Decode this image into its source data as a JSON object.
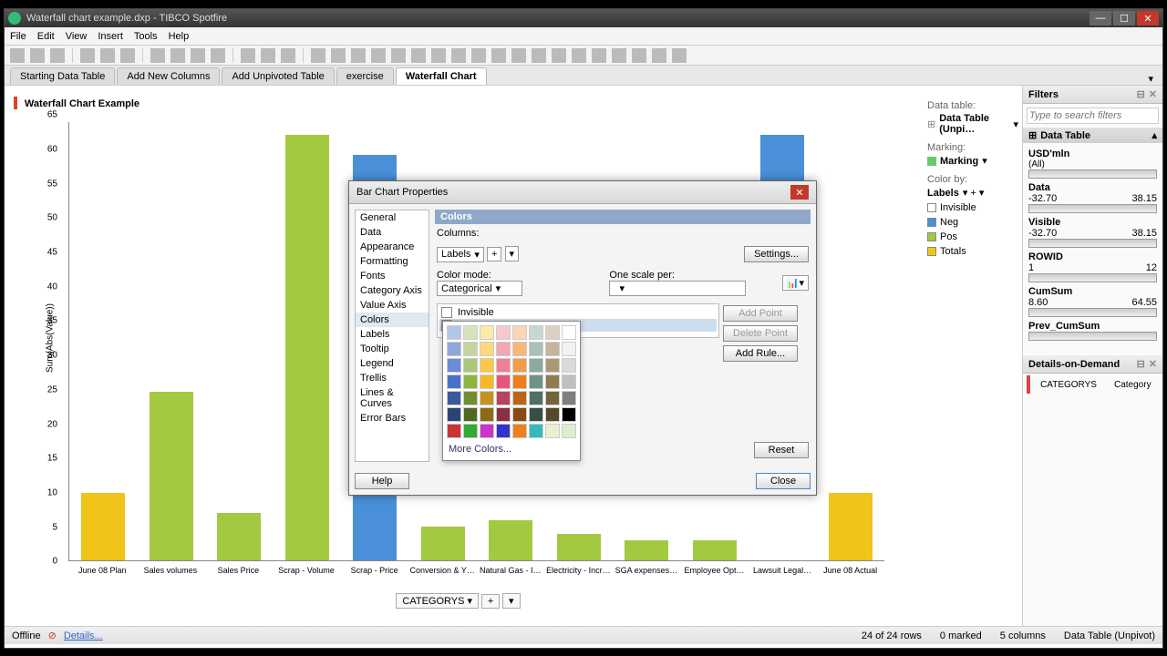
{
  "app": {
    "title": "Waterfall chart example.dxp - TIBCO Spotfire"
  },
  "menu": [
    "File",
    "Edit",
    "View",
    "Insert",
    "Tools",
    "Help"
  ],
  "tabs": [
    "Starting Data Table",
    "Add New Columns",
    "Add Unpivoted Table",
    "exercise",
    "Waterfall Chart"
  ],
  "active_tab": "Waterfall Chart",
  "page_title": "Waterfall Chart Example",
  "y_axis_label": "Sum(Abs(Value))",
  "x_axis_control": "CATEGORYS",
  "chart_data": {
    "type": "bar",
    "categories": [
      "June 08 Plan",
      "Sales volumes",
      "Sales Price",
      "Scrap - Volume",
      "Scrap - Price",
      "Conversion & Y…",
      "Natural Gas - I…",
      "Electricity - Incr…",
      "SGA expenses…",
      "Employee Opt…",
      "Lawsuit Legal…",
      "June 08 Actual"
    ],
    "values": [
      10,
      25,
      7,
      63,
      60,
      5,
      6,
      4,
      3,
      3,
      11,
      10
    ],
    "bar_bottoms": [
      0,
      0,
      0,
      0,
      0,
      0,
      0,
      0,
      0,
      0,
      52,
      0
    ],
    "colors": [
      "#f0c419",
      "#a2c940",
      "#a2c940",
      "#a2c940",
      "#4a90d9",
      "#a2c940",
      "#a2c940",
      "#a2c940",
      "#a2c940",
      "#a2c940",
      "#4a90d9",
      "#f0c419"
    ],
    "y_ticks": [
      0,
      5,
      10,
      15,
      20,
      25,
      30,
      35,
      40,
      45,
      50,
      55,
      60,
      65
    ],
    "y_max": 65
  },
  "legend": {
    "data_table_label": "Data table:",
    "data_table_value": "Data Table (Unpi…",
    "marking_label": "Marking:",
    "marking_value": "Marking",
    "colorby_label": "Color by:",
    "colorby_value": "Labels",
    "items": [
      {
        "label": "Invisible",
        "color": "#ffffff"
      },
      {
        "label": "Neg",
        "color": "#4a90d9"
      },
      {
        "label": "Pos",
        "color": "#a2c940"
      },
      {
        "label": "Totals",
        "color": "#f0c419"
      }
    ]
  },
  "filters": {
    "title": "Filters",
    "search_placeholder": "Type to search filters",
    "group": "Data Table",
    "items": [
      {
        "name": "USD'mln",
        "sub": "(All)"
      },
      {
        "name": "Data",
        "min": "-32.70",
        "max": "38.15"
      },
      {
        "name": "Visible",
        "min": "-32.70",
        "max": "38.15"
      },
      {
        "name": "ROWID",
        "min": "1",
        "max": "12"
      },
      {
        "name": "CumSum",
        "min": "8.60",
        "max": "64.55"
      },
      {
        "name": "Prev_CumSum",
        "min": "",
        "max": ""
      }
    ]
  },
  "dod": {
    "title": "Details-on-Demand",
    "cols": [
      "CATEGORYS",
      "Category"
    ]
  },
  "status": {
    "offline": "Offline",
    "details": "Details...",
    "rows": "24 of 24 rows",
    "marked": "0 marked",
    "columns": "5 columns",
    "table": "Data Table (Unpivot)"
  },
  "dialog": {
    "title": "Bar Chart Properties",
    "nav": [
      "General",
      "Data",
      "Appearance",
      "Formatting",
      "Fonts",
      "Category Axis",
      "Value Axis",
      "Colors",
      "Labels",
      "Tooltip",
      "Legend",
      "Trellis",
      "Lines & Curves",
      "Error Bars"
    ],
    "nav_selected": "Colors",
    "section": "Colors",
    "columns_label": "Columns:",
    "columns_value": "Labels",
    "settings_btn": "Settings...",
    "color_mode_label": "Color mode:",
    "color_mode_value": "Categorical",
    "one_scale_label": "One scale per:",
    "list": [
      {
        "label": "Invisible",
        "color": "#ffffff"
      },
      {
        "label": "Neg",
        "color": "#4a90d9"
      }
    ],
    "list_selected": "Neg",
    "add_point": "Add Point",
    "delete_point": "Delete Point",
    "add_rule": "Add Rule...",
    "reset": "Reset",
    "help": "Help",
    "close": "Close"
  },
  "color_popup": {
    "more": "More Colors...",
    "colors": [
      "#b3c6e7",
      "#d5e3bd",
      "#fde9a9",
      "#f9c7ce",
      "#fbd5b5",
      "#c6d9d1",
      "#ddd0c0",
      "#ffffff",
      "#8fa8da",
      "#c2d69b",
      "#fcd979",
      "#f4a6b5",
      "#f7b777",
      "#a8c2b8",
      "#c4b59a",
      "#f2f2f2",
      "#6b8dd6",
      "#a9c776",
      "#fac748",
      "#ee7f96",
      "#f39b48",
      "#8aab9f",
      "#aa9974",
      "#d9d9d9",
      "#4a72c8",
      "#8fb53f",
      "#f7b728",
      "#e7547a",
      "#ee7f1a",
      "#6c9489",
      "#8f7d4f",
      "#bfbfbf",
      "#3b5ba0",
      "#6f8f2f",
      "#c6921f",
      "#b9425f",
      "#be6513",
      "#4e7066",
      "#726438",
      "#7f7f7f",
      "#2c4376",
      "#4f681f",
      "#8e6a15",
      "#8a3045",
      "#8a490d",
      "#364e46",
      "#544926",
      "#000000",
      "#cc3333",
      "#33aa33",
      "#cc33cc",
      "#3333cc",
      "#ee7f1a",
      "#33bbbb",
      "#eeeecc",
      "#ddeecc"
    ]
  }
}
